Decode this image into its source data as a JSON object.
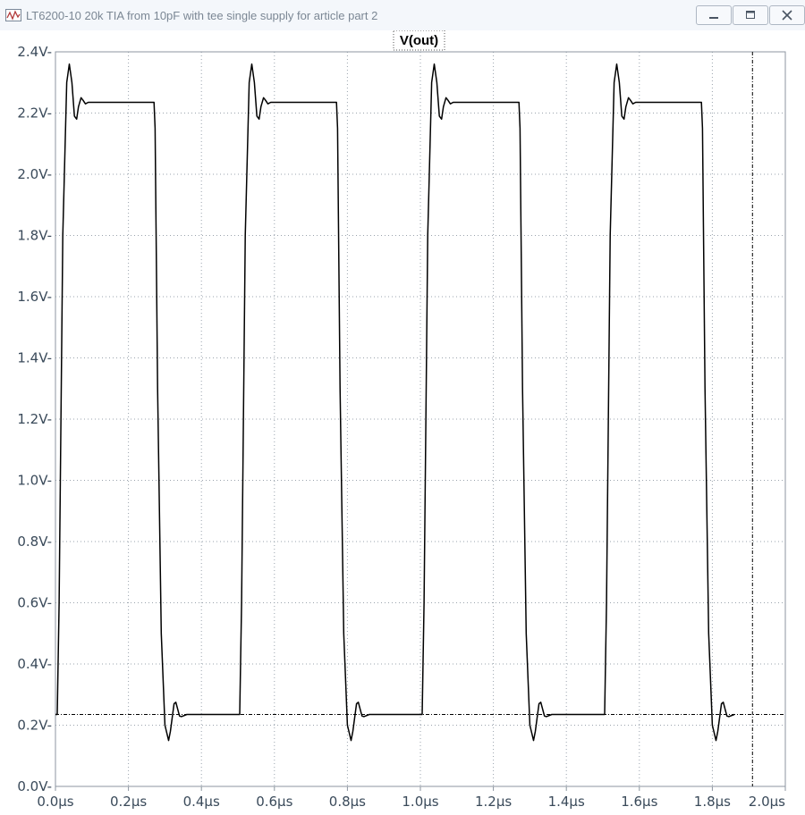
{
  "window": {
    "title": "LT6200-10 20k TIA from 10pF with tee single supply for article part 2",
    "icon": "waveform-viewer-icon",
    "buttons": [
      "minimize-icon",
      "maximize-icon",
      "close-icon"
    ]
  },
  "chart_data": {
    "type": "line",
    "title": "V(out)",
    "xlabel": "",
    "ylabel": "",
    "xlim": [
      0,
      2.0
    ],
    "ylim": [
      0,
      2.4
    ],
    "x_unit": "µs",
    "y_unit": "V",
    "grid": true,
    "x_ticks": [
      "0.0µs",
      "0.2µs",
      "0.4µs",
      "0.6µs",
      "0.8µs",
      "1.0µs",
      "1.2µs",
      "1.4µs",
      "1.6µs",
      "1.8µs",
      "2.0µs"
    ],
    "y_ticks": [
      "0.0V-",
      "0.2V-",
      "0.4V-",
      "0.6V-",
      "0.8V-",
      "1.0V-",
      "1.2V-",
      "1.4V-",
      "1.6V-",
      "1.8V-",
      "2.0V-",
      "2.2V-",
      "2.4V-"
    ],
    "series": [
      {
        "name": "V(out)",
        "color": "#000000",
        "x": [
          0.0,
          0.005,
          0.01,
          0.02,
          0.031,
          0.038,
          0.045,
          0.052,
          0.058,
          0.063,
          0.07,
          0.075,
          0.082,
          0.09,
          0.1,
          0.15,
          0.2,
          0.27,
          0.273,
          0.28,
          0.29,
          0.3,
          0.31,
          0.315,
          0.325,
          0.33,
          0.34,
          0.345,
          0.36,
          0.4,
          0.45,
          0.5,
          0.505,
          0.51,
          0.52,
          0.531,
          0.538,
          0.545,
          0.552,
          0.558,
          0.563,
          0.57,
          0.575,
          0.582,
          0.59,
          0.6,
          0.65,
          0.7,
          0.77,
          0.773,
          0.78,
          0.79,
          0.8,
          0.81,
          0.815,
          0.825,
          0.83,
          0.84,
          0.845,
          0.86,
          0.9,
          0.95,
          1.0,
          1.005,
          1.01,
          1.02,
          1.031,
          1.038,
          1.045,
          1.052,
          1.058,
          1.063,
          1.07,
          1.075,
          1.082,
          1.09,
          1.1,
          1.15,
          1.2,
          1.27,
          1.273,
          1.28,
          1.29,
          1.3,
          1.31,
          1.315,
          1.325,
          1.33,
          1.34,
          1.345,
          1.36,
          1.4,
          1.45,
          1.5,
          1.505,
          1.51,
          1.52,
          1.531,
          1.538,
          1.545,
          1.552,
          1.558,
          1.563,
          1.57,
          1.575,
          1.582,
          1.59,
          1.6,
          1.65,
          1.7,
          1.77,
          1.773,
          1.78,
          1.79,
          1.8,
          1.81,
          1.815,
          1.825,
          1.83,
          1.84,
          1.845,
          1.86
        ],
        "y": [
          0.235,
          0.235,
          0.6,
          1.8,
          2.3,
          2.36,
          2.3,
          2.19,
          2.18,
          2.22,
          2.25,
          2.243,
          2.23,
          2.235,
          2.235,
          2.235,
          2.235,
          2.235,
          2.15,
          1.3,
          0.5,
          0.2,
          0.15,
          0.18,
          0.27,
          0.275,
          0.23,
          0.228,
          0.235,
          0.235,
          0.235,
          0.235,
          0.235,
          0.6,
          1.8,
          2.3,
          2.36,
          2.3,
          2.19,
          2.18,
          2.22,
          2.25,
          2.243,
          2.23,
          2.235,
          2.235,
          2.235,
          2.235,
          2.235,
          2.15,
          1.3,
          0.5,
          0.2,
          0.15,
          0.18,
          0.27,
          0.275,
          0.23,
          0.228,
          0.235,
          0.235,
          0.235,
          0.235,
          0.235,
          0.6,
          1.8,
          2.3,
          2.36,
          2.3,
          2.19,
          2.18,
          2.22,
          2.25,
          2.243,
          2.23,
          2.235,
          2.235,
          2.235,
          2.235,
          2.235,
          2.15,
          1.3,
          0.5,
          0.2,
          0.15,
          0.18,
          0.27,
          0.275,
          0.23,
          0.228,
          0.235,
          0.235,
          0.235,
          0.235,
          0.235,
          0.6,
          1.8,
          2.3,
          2.36,
          2.3,
          2.19,
          2.18,
          2.22,
          2.25,
          2.243,
          2.23,
          2.235,
          2.235,
          2.235,
          2.235,
          2.235,
          2.15,
          1.3,
          0.5,
          0.2,
          0.15,
          0.18,
          0.27,
          0.275,
          0.23,
          0.228,
          0.235
        ]
      }
    ],
    "annotations": [
      {
        "type": "horizontal-cursor",
        "y": 0.235,
        "style": "dash-dot"
      },
      {
        "type": "vertical-cursor",
        "x": 1.91,
        "style": "dash-dot"
      }
    ]
  }
}
